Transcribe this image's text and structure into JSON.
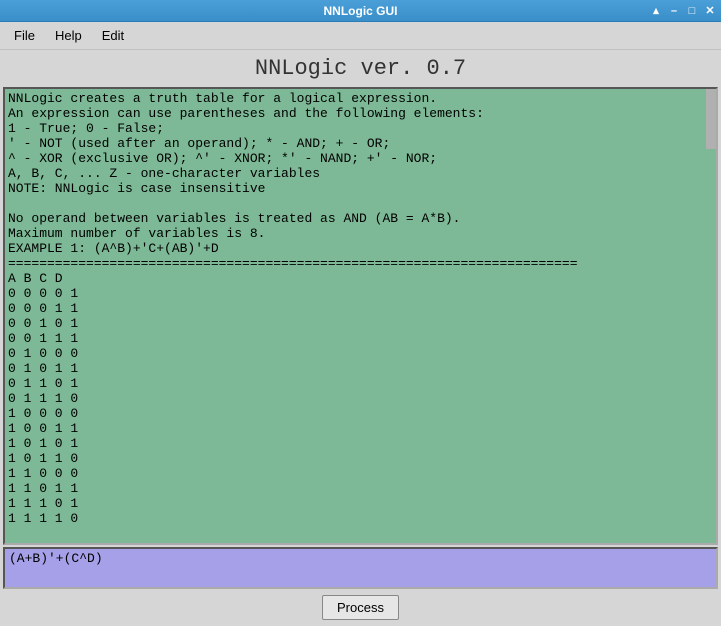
{
  "window": {
    "title": "NNLogic GUI"
  },
  "menubar": {
    "items": [
      "File",
      "Help",
      "Edit"
    ]
  },
  "app_header": "NNLogic ver. 0.7",
  "output": {
    "help_lines": [
      "NNLogic creates a truth table for a logical expression.",
      "An expression can use parentheses and the following elements:",
      "1 - True; 0 - False;",
      "' - NOT (used after an operand); * - AND; + - OR;",
      "^ - XOR (exclusive OR); ^' - XNOR; *' - NAND; +' - NOR;",
      "A, B, C, ... Z - one-character variables",
      "NOTE: NNLogic is case insensitive",
      "",
      "No operand between variables is treated as AND (AB = A*B).",
      "Maximum number of variables is 8.",
      "EXAMPLE 1: (A^B)+'C+(AB)'+D"
    ],
    "separator": "=========================================================================",
    "table_header": "A B C D",
    "table_rows": [
      "0 0 0 0 1",
      "0 0 0 1 1",
      "0 0 1 0 1",
      "0 0 1 1 1",
      "0 1 0 0 0",
      "0 1 0 1 1",
      "0 1 1 0 1",
      "0 1 1 1 0",
      "1 0 0 0 0",
      "1 0 0 1 1",
      "1 0 1 0 1",
      "1 0 1 1 0",
      "1 1 0 0 0",
      "1 1 0 1 1",
      "1 1 1 0 1",
      "1 1 1 1 0"
    ]
  },
  "input": {
    "value": "(A+B)'+(C^D)"
  },
  "buttons": {
    "process": "Process"
  }
}
